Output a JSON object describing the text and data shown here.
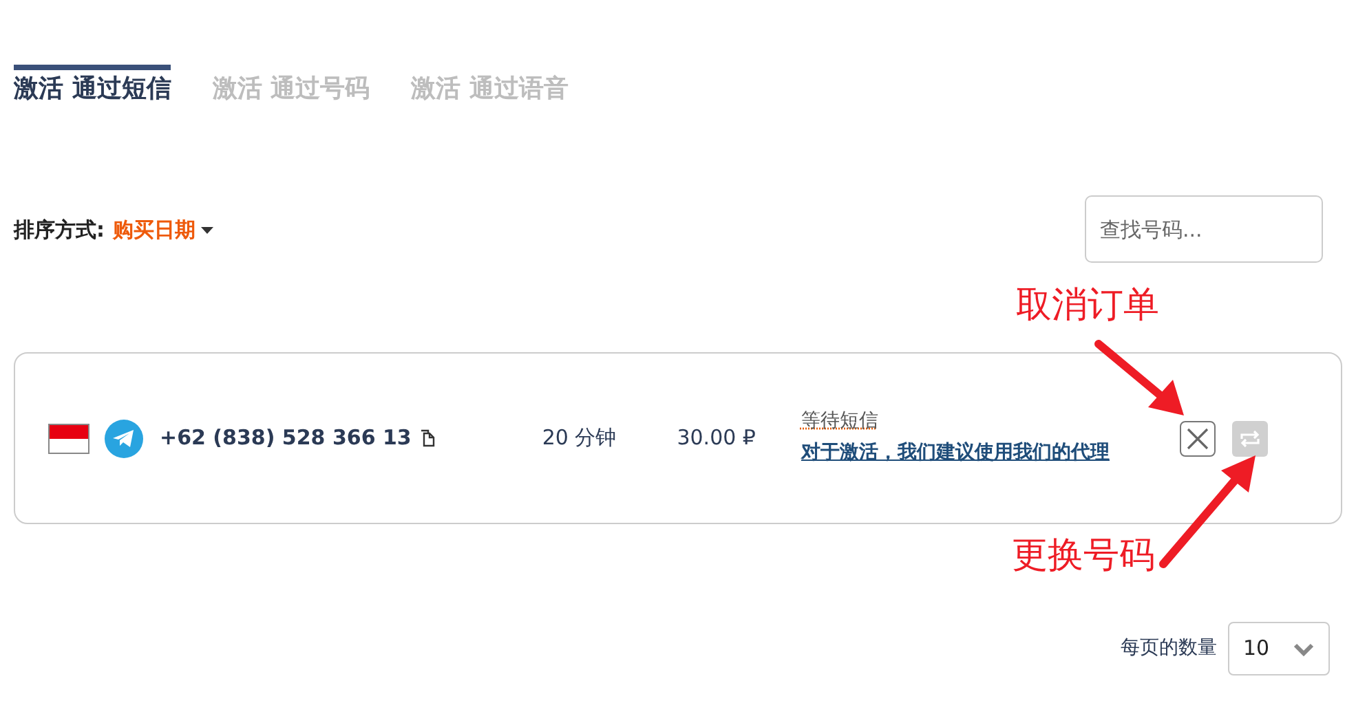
{
  "tabs": [
    {
      "label": "激活 通过短信",
      "selected": true
    },
    {
      "label": "激活 通过号码",
      "selected": false
    },
    {
      "label": "激活 通过语音",
      "selected": false
    }
  ],
  "sort": {
    "label": "排序方式:",
    "value": "购买日期"
  },
  "search": {
    "placeholder": "查找号码..."
  },
  "orders": [
    {
      "phone": "+62 (838) 528 366 13",
      "duration": "20 分钟",
      "price": "30.00 ₽",
      "status": "等待短信",
      "proxy_link": "对于激活，我们建议使用我们的代理",
      "replace_disabled": true
    }
  ],
  "annotations": [
    {
      "text": "取消订单",
      "kind": "above"
    },
    {
      "text": "更换号码",
      "kind": "below"
    }
  ],
  "pagination": {
    "label": "每页的数量",
    "value": "10"
  }
}
